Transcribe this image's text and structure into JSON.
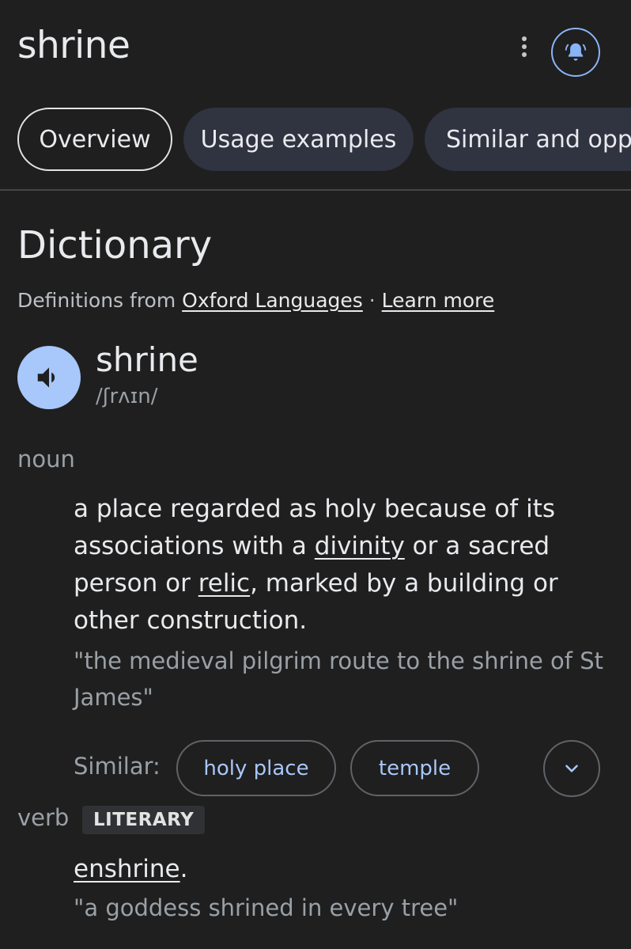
{
  "header": {
    "title": "shrine",
    "more_icon": "more-vert-icon",
    "alert_icon": "notification-bell-icon"
  },
  "tabs": [
    {
      "label": "Overview",
      "active": true
    },
    {
      "label": "Usage examples",
      "active": false
    },
    {
      "label": "Similar and opposite words",
      "active": false
    }
  ],
  "dictionary": {
    "heading": "Dictionary",
    "source_prefix": "Definitions from",
    "source_link": "Oxford Languages",
    "separator": "·",
    "learn_more": "Learn more",
    "word": "shrine",
    "phonetic": "/ʃrʌɪn/",
    "speaker_icon": "volume-icon",
    "entries": [
      {
        "part_of_speech": "noun",
        "definition": {
          "t1": "a place regarded as holy because of its associations with a ",
          "link1": "divinity",
          "t2": " or a sacred person or ",
          "link2": "relic",
          "t3": ", marked by a building or other construction."
        },
        "example": "\"the medieval pilgrim route to the shrine of St James\"",
        "similar_label": "Similar:",
        "similar": [
          "holy place",
          "temple"
        ],
        "expand_icon": "chevron-down-icon"
      },
      {
        "part_of_speech": "verb",
        "register": "LITERARY",
        "definition": {
          "link": "enshrine",
          "suffix": "."
        },
        "example": "\"a goddess shrined in every tree\""
      }
    ]
  },
  "colors": {
    "background": "#1f1f1f",
    "accent": "#8ab4f8",
    "speaker_fill": "#a8c7fa",
    "chip_text": "#a8c7fa",
    "tab_fill": "#303340"
  }
}
